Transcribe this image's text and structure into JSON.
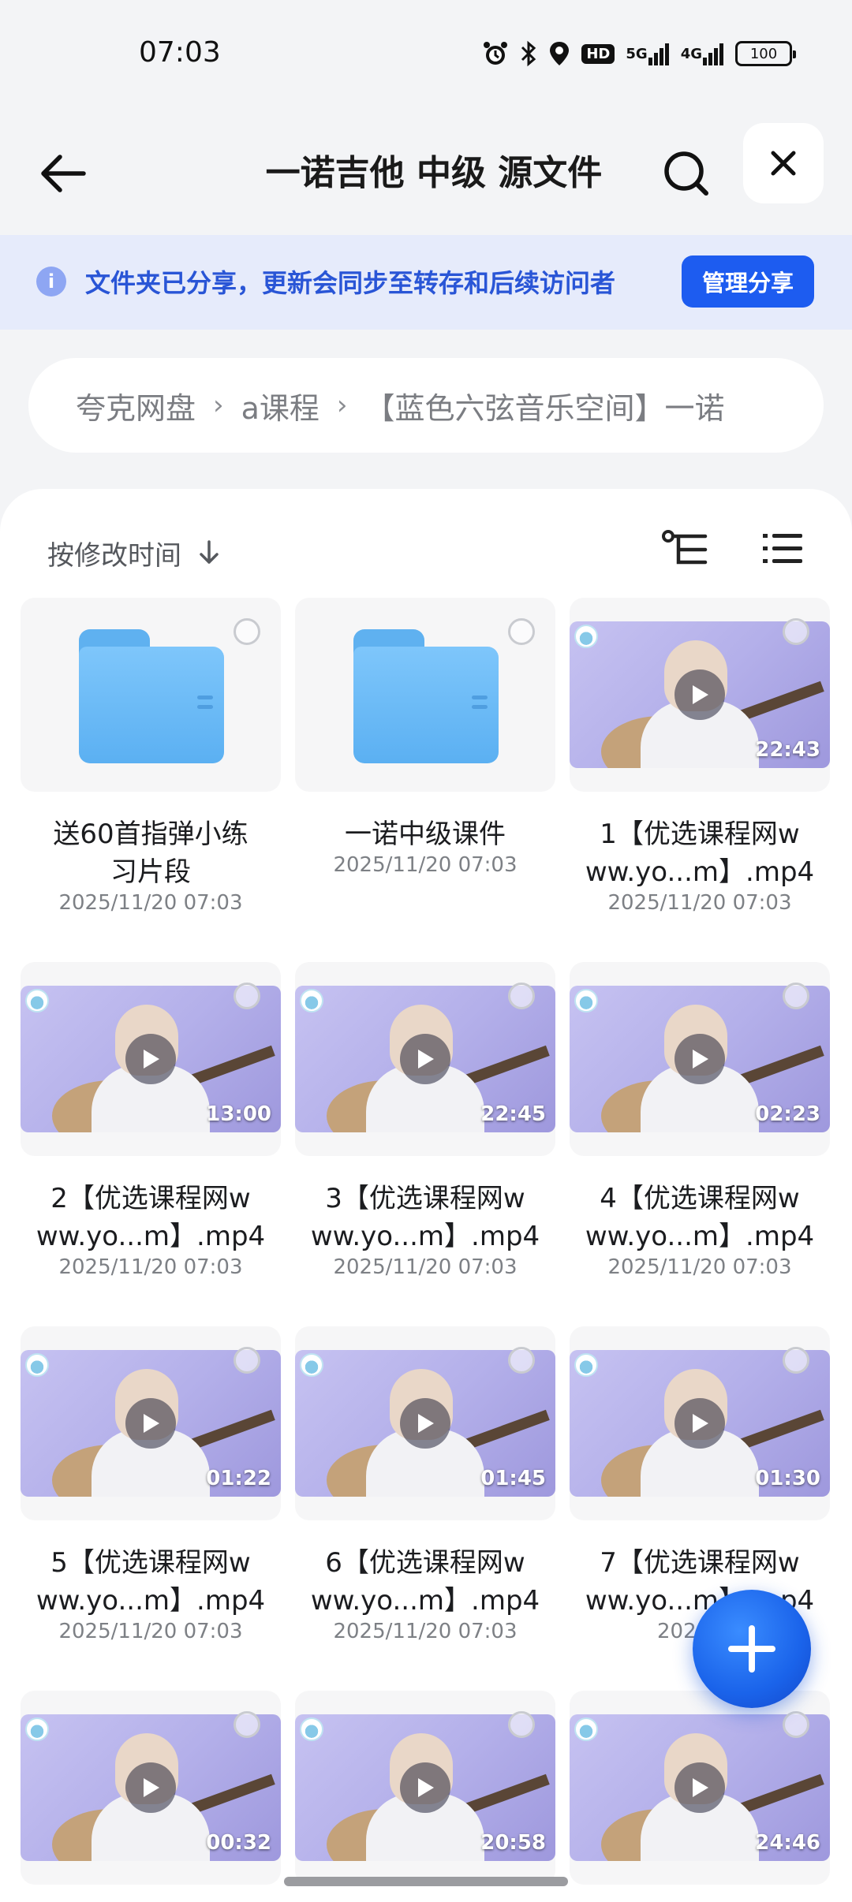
{
  "status": {
    "time": "07:03",
    "hd": "HD",
    "sig1": "5G",
    "sig2": "4G",
    "battery": "100"
  },
  "topbar": {
    "title": "一诺吉他 中级 源文件"
  },
  "banner": {
    "text": "文件夹已分享，更新会同步至转存和后续访问者",
    "manage_label": "管理分享"
  },
  "breadcrumb": {
    "items": [
      "夸克网盘",
      "a课程",
      "【蓝色六弦音乐空间】一诺"
    ]
  },
  "sort": {
    "label": "按修改时间"
  },
  "files": [
    {
      "type": "folder",
      "name_l1": "送60首指弹小练",
      "name_l2": "习片段",
      "date": "2025/11/20 07:03"
    },
    {
      "type": "folder",
      "name_l1": "一诺中级课件",
      "name_l2": "",
      "date": "2025/11/20 07:03"
    },
    {
      "type": "video",
      "name_l1": "1【优选课程网w",
      "name_l2": "ww.yo...m】.mp4",
      "date": "2025/11/20 07:03",
      "duration": "22:43"
    },
    {
      "type": "video",
      "name_l1": "2【优选课程网w",
      "name_l2": "ww.yo...m】.mp4",
      "date": "2025/11/20 07:03",
      "duration": "13:00"
    },
    {
      "type": "video",
      "name_l1": "3【优选课程网w",
      "name_l2": "ww.yo...m】.mp4",
      "date": "2025/11/20 07:03",
      "duration": "22:45"
    },
    {
      "type": "video",
      "name_l1": "4【优选课程网w",
      "name_l2": "ww.yo...m】.mp4",
      "date": "2025/11/20 07:03",
      "duration": "02:23"
    },
    {
      "type": "video",
      "name_l1": "5【优选课程网w",
      "name_l2": "ww.yo...m】.mp4",
      "date": "2025/11/20 07:03",
      "duration": "01:22"
    },
    {
      "type": "video",
      "name_l1": "6【优选课程网w",
      "name_l2": "ww.yo...m】.mp4",
      "date": "2025/11/20 07:03",
      "duration": "01:45"
    },
    {
      "type": "video",
      "name_l1": "7【优选课程网w",
      "name_l2": "ww.yo...m】.mp4",
      "date": "2025/11",
      "duration": "01:30"
    },
    {
      "type": "video",
      "name_l1": "",
      "name_l2": "",
      "date": "",
      "duration": "00:32"
    },
    {
      "type": "video",
      "name_l1": "",
      "name_l2": "",
      "date": "",
      "duration": "20:58"
    },
    {
      "type": "video",
      "name_l1": "",
      "name_l2": "",
      "date": "",
      "duration": "24:46"
    }
  ],
  "colors": {
    "accent": "#1d5cf0",
    "banner_bg": "#e6ebfb",
    "banner_text": "#2955d6"
  }
}
